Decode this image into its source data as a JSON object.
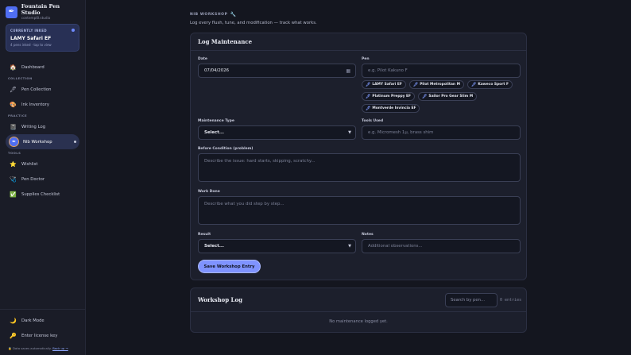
{
  "brand": {
    "title": "Fountain Pen Studio",
    "subtitle": "contempl8.studio"
  },
  "inked": {
    "label": "CURRENTLY INKED",
    "pen": "LAMY Safari EF",
    "meta": "4 pens inked · tap to view"
  },
  "nav": {
    "dashboard": "Dashboard",
    "section_collection": "COLLECTION",
    "pen_collection": "Pen Collection",
    "ink_inventory": "Ink Inventory",
    "section_practice": "PRACTICE",
    "writing_log": "Writing Log",
    "nib_workshop": "Nib Workshop",
    "section_tools": "TOOLS",
    "wishlist": "Wishlist",
    "pen_doctor": "Pen Doctor",
    "supplies_checklist": "Supplies Checklist"
  },
  "footer": {
    "dark_mode": "Dark Mode",
    "license": "Enter license key",
    "saved_note": "Data saves automatically.",
    "back_up": "Back up →"
  },
  "page": {
    "heading": "NIB WORKSHOP",
    "subtitle": "Log every flush, tune, and modification — track what works."
  },
  "form": {
    "title": "Log Maintenance",
    "date_label": "Date",
    "date_value": "07/04/2026",
    "pen_label": "Pen",
    "pen_placeholder": "e.g. Pilot Kakuno F",
    "pen_chips": [
      "LAMY Safari EF",
      "Pilot Metropolitan M",
      "Kaweco Sport F",
      "Platinum Preppy EF",
      "Sailor Pro Gear Slim M",
      "Montverde Invincia EF"
    ],
    "type_label": "Maintenance Type",
    "type_value": "Select...",
    "tools_label": "Tools Used",
    "tools_placeholder": "e.g. Micromesh 1µ, brass shim",
    "before_label": "Before Condition (problem)",
    "before_placeholder": "Describe the issue: hard starts, skipping, scratchy...",
    "work_label": "Work Done",
    "work_placeholder": "Describe what you did step by step...",
    "result_label": "Result",
    "result_value": "Select...",
    "notes_label": "Notes",
    "notes_placeholder": "Additional observations...",
    "save_button": "Save Workshop Entry"
  },
  "log": {
    "title": "Workshop Log",
    "search_placeholder": "Search by pen...",
    "count": "0 entries",
    "empty": "No maintenance logged yet."
  },
  "colors": {
    "accent": "#4f6ef2",
    "button": "#7f93ff",
    "background": "#14161f"
  }
}
